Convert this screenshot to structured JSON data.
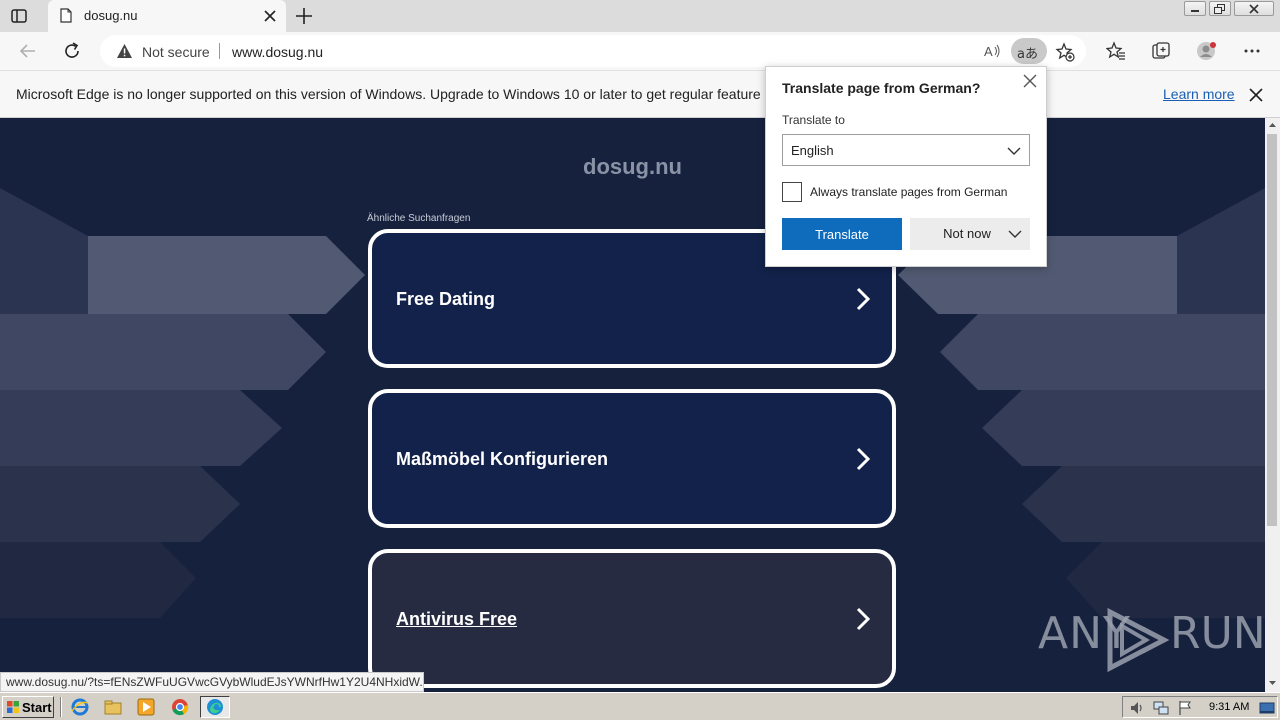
{
  "browser": {
    "tab": {
      "title": "dosug.nu"
    },
    "address": {
      "security_label": "Not secure",
      "url": "www.dosug.nu"
    },
    "translate_icon_text": "aあ"
  },
  "infobar": {
    "message": "Microsoft Edge is no longer supported on this version of Windows. Upgrade to Windows 10 or later to get regular feature and",
    "link": "Learn more"
  },
  "page": {
    "site_title": "dosug.nu",
    "related_label": "Ähnliche Suchanfragen",
    "cards": [
      {
        "label": "Free Dating"
      },
      {
        "label": "Maßmöbel Konfigurieren"
      },
      {
        "label": "Antivirus Free"
      }
    ],
    "watermark": {
      "left": "ANY",
      "right": "RUN"
    }
  },
  "status_url": "www.dosug.nu/?ts=fENsZWFuUGVwcGVybWludEJsYWNrfHw1Y2U4NHxidW...",
  "translate_popup": {
    "title": "Translate page from German?",
    "translate_to_label": "Translate to",
    "selected_language": "English",
    "always_label": "Always translate pages from German",
    "always_checked": false,
    "translate_button": "Translate",
    "not_now_button": "Not now"
  },
  "taskbar": {
    "start_label": "Start",
    "clock": "9:31 AM"
  },
  "colors": {
    "page_bg": "#16213e",
    "card_border": "#ffffff",
    "translate_button": "#0f6cbd",
    "link": "#1a5fb4"
  }
}
